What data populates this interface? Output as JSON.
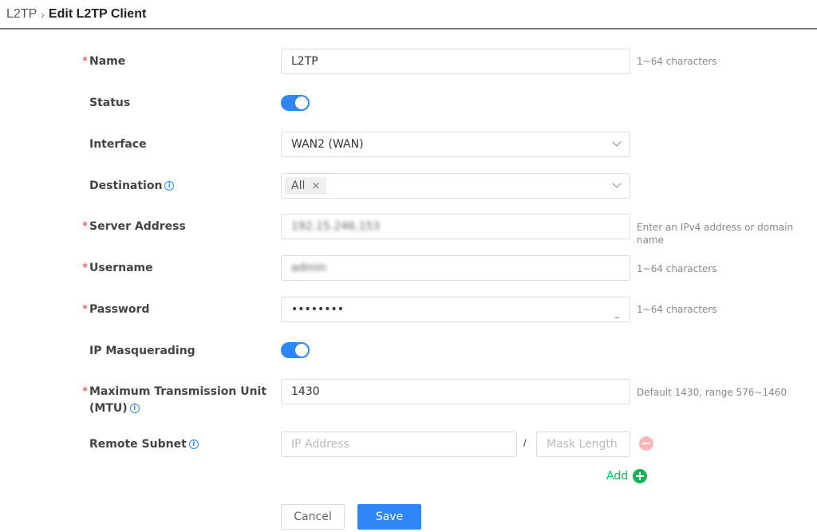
{
  "breadcrumb": {
    "parent": "L2TP",
    "separator": "›",
    "current": "Edit L2TP Client"
  },
  "fields": {
    "name": {
      "label": "Name",
      "value": "L2TP",
      "hint": "1~64 characters"
    },
    "status": {
      "label": "Status",
      "enabled": true
    },
    "interface": {
      "label": "Interface",
      "value": "WAN2 (WAN)"
    },
    "destination": {
      "label": "Destination",
      "tag": "All",
      "tag_remove": "×"
    },
    "server_address": {
      "label": "Server Address",
      "value": "192.15.246.153",
      "hint": "Enter an IPv4 address or domain name"
    },
    "username": {
      "label": "Username",
      "value": "admin",
      "hint": "1~64 characters"
    },
    "password": {
      "label": "Password",
      "value": "••••••••",
      "hint": "1~64 characters"
    },
    "ip_masquerading": {
      "label": "IP Masquerading",
      "enabled": true
    },
    "mtu": {
      "label_line1": "Maximum Transmission Unit",
      "label_line2": "(MTU)",
      "value": "1430",
      "hint": "Default 1430, range 576~1460"
    },
    "remote_subnet": {
      "label": "Remote Subnet",
      "ip_placeholder": "IP Address",
      "separator": "/",
      "mask_placeholder": "Mask Length",
      "remove": "−"
    }
  },
  "actions": {
    "add_label": "Add",
    "add_icon": "+",
    "cancel_label": "Cancel",
    "save_label": "Save"
  },
  "required_mark": "*",
  "icons": {
    "info": "i",
    "eye_hidden": "⌣"
  },
  "colors": {
    "accent": "#2f86f6",
    "add_green": "#19b25b",
    "required_red": "#e53935"
  }
}
